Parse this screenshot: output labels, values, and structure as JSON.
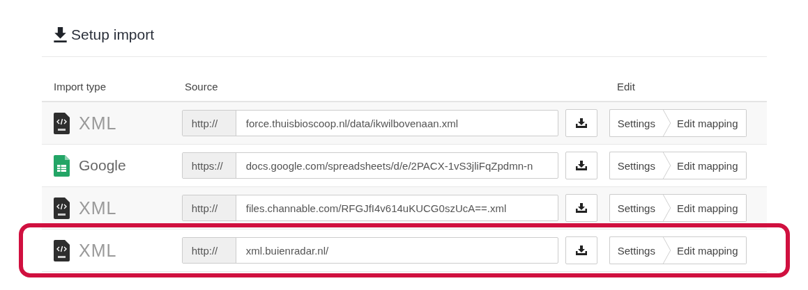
{
  "title": "Setup import",
  "columns": [
    "Import type",
    "Source",
    "Edit"
  ],
  "rows": [
    {
      "kind": "xml",
      "type_label": "XML",
      "protocol": "http://",
      "url": "force.thuisbioscoop.nl/data/ikwilbovenaan.xml",
      "settings": "Settings",
      "mapping": "Edit mapping",
      "highlighted": false
    },
    {
      "kind": "google",
      "type_label": "Google",
      "protocol": "https://",
      "url": "docs.google.com/spreadsheets/d/e/2PACX-1vS3jliFqZpdmn-n",
      "settings": "Settings",
      "mapping": "Edit mapping",
      "highlighted": false
    },
    {
      "kind": "xml",
      "type_label": "XML",
      "protocol": "http://",
      "url": "files.channable.com/RFGJfI4v614uKUCG0szUcA==.xml",
      "settings": "Settings",
      "mapping": "Edit mapping",
      "highlighted": false
    },
    {
      "kind": "xml",
      "type_label": "XML",
      "protocol": "http://",
      "url": "xml.buienradar.nl/",
      "settings": "Settings",
      "mapping": "Edit mapping",
      "highlighted": true
    }
  ]
}
